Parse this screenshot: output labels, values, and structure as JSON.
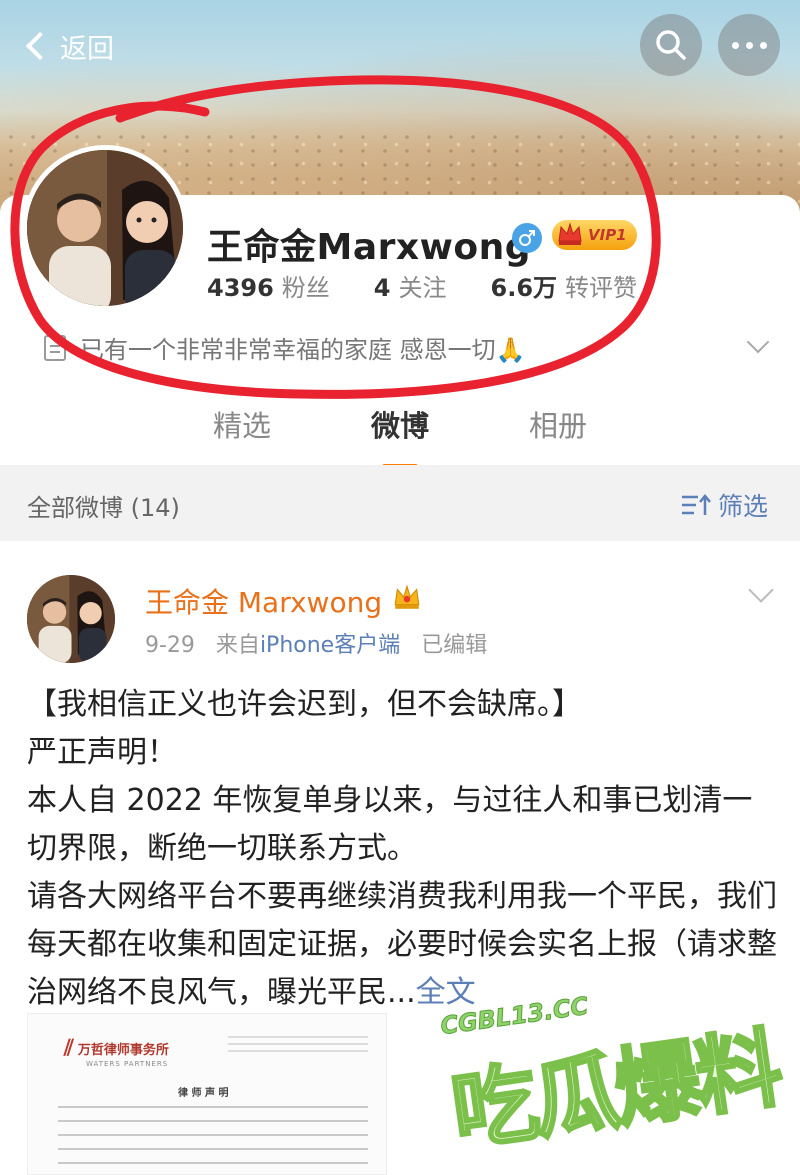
{
  "header": {
    "back_label": "返回"
  },
  "icons": {
    "back": "chevron-left-icon",
    "search": "search-icon",
    "more": "more-dots-icon",
    "gender": "male-icon",
    "vip": "vip-crown-icon",
    "bio": "document-icon",
    "filter": "filter-icon"
  },
  "profile": {
    "name": "王命金Marxwong",
    "vip_label": "VIP1",
    "stats": [
      {
        "value": "4396",
        "label": "粉丝"
      },
      {
        "value": "4",
        "label": "关注"
      },
      {
        "value": "6.6万",
        "label": "转评赞"
      }
    ],
    "bio": "已有一个非常非常幸福的家庭 感恩一切🙏"
  },
  "tabs": [
    {
      "label": "精选",
      "active": false
    },
    {
      "label": "微博",
      "active": true
    },
    {
      "label": "相册",
      "active": false
    }
  ],
  "filter": {
    "count_label": "全部微博 (14)",
    "button_label": "筛选"
  },
  "post": {
    "author": "王命金 Marxwong",
    "date": "9-29",
    "from_prefix": "来自",
    "source": "iPhone客户端",
    "edited": "已编辑",
    "lines": [
      "【我相信正义也许会迟到，但不会缺席。】",
      "严正声明！",
      "本人自 2022 年恢复单身以来，与过往人和事已划清一切界限，断绝一切联系方式。",
      "请各大网络平台不要再继续消费我利用我一个平民，我们每天都在收集和固定证据，必要时候会实名上报（请求整治网络不良风气，曝光平民..."
    ],
    "more_label": "全文",
    "attachment": {
      "firm_name": "万哲律师事务所",
      "firm_en": "WATERS PARTNERS",
      "doc_title": "律 师 声 明"
    }
  },
  "watermark": {
    "url": "CGBL13.CC",
    "text": "吃瓜爆料"
  },
  "colors": {
    "accent_orange": "#ff7a00",
    "name_orange": "#e8711a",
    "link_blue": "#5b7fb6",
    "annotation_red": "#e8232f",
    "watermark_green": "#7cc04c"
  }
}
